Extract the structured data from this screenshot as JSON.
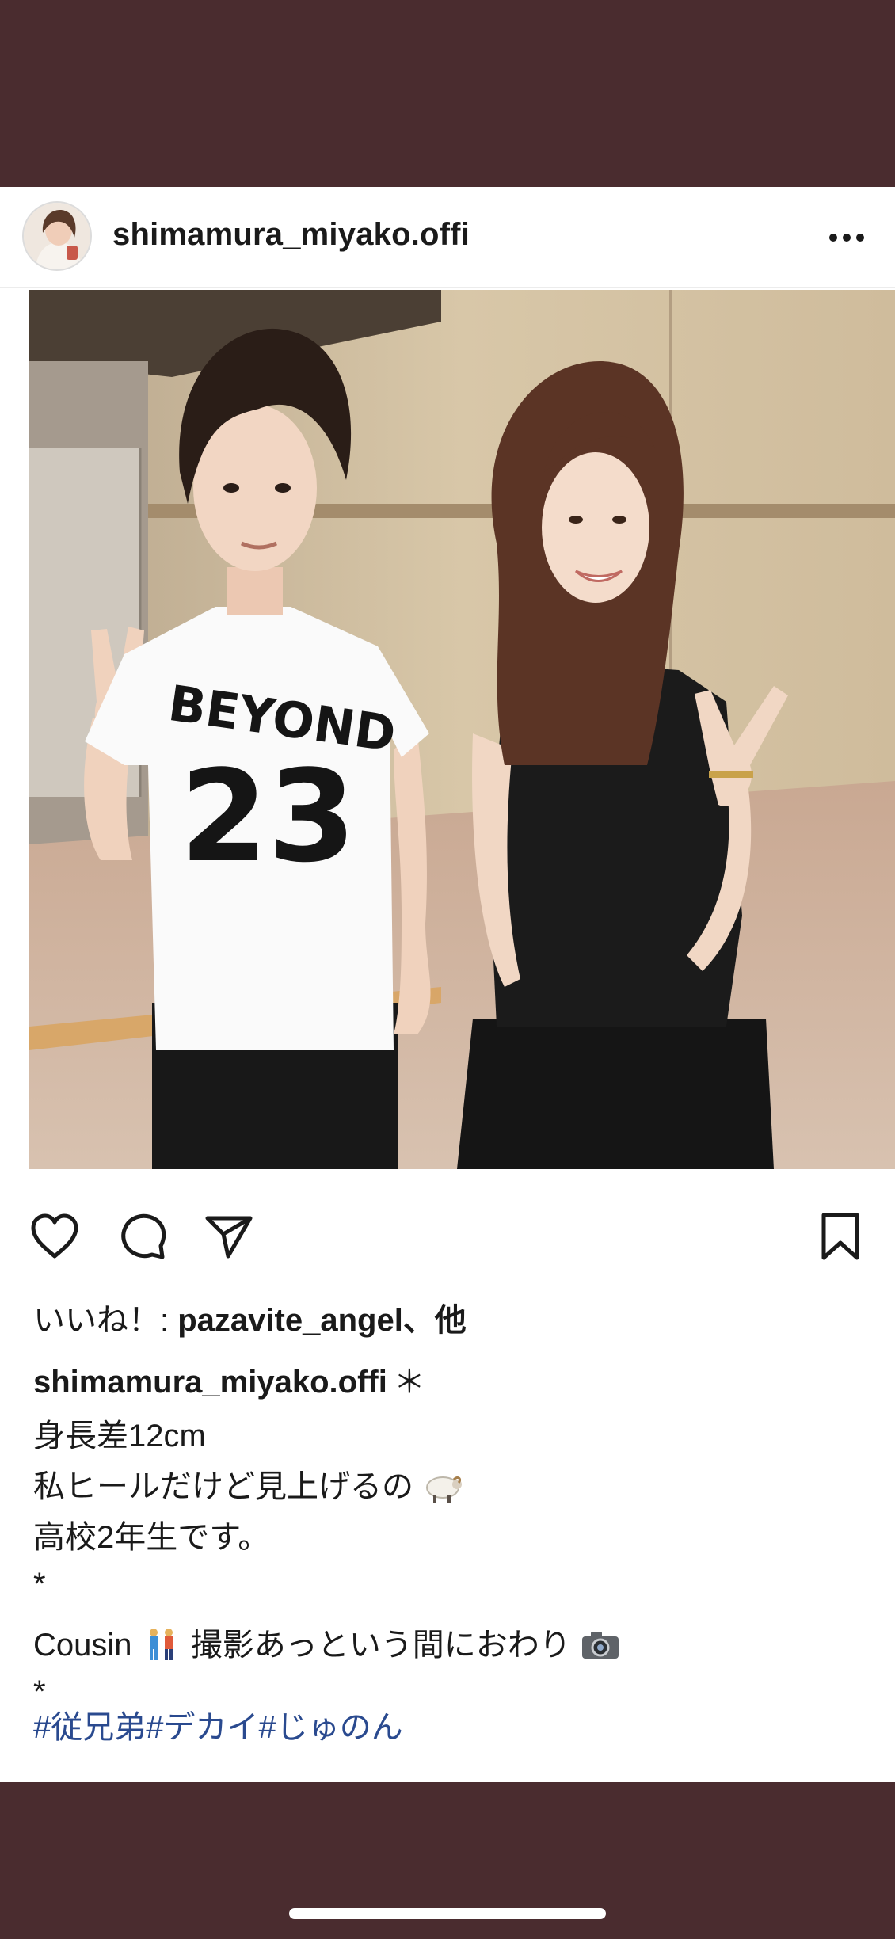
{
  "post": {
    "username": "shimamura_miyako.offi",
    "likes_prefix": "いいね！: ",
    "likes_user": "pazavite_angel",
    "likes_suffix": "、他",
    "caption_user": "shimamura_miyako.offi",
    "caption_star": "＊",
    "caption_lines": [
      "身長差12cm",
      "私ヒールだけど見上げるの",
      "高校2年生です。",
      "*",
      "Cousin",
      "撮影あっという間におわり",
      "*"
    ],
    "hashtags": [
      "#従兄弟",
      "#デカイ",
      "#じゅのん"
    ],
    "photo": {
      "shirt_text": "BEYOND",
      "shirt_number": "23"
    }
  },
  "icons": [
    "more-icon",
    "heart-icon",
    "comment-icon",
    "share-icon",
    "bookmark-icon",
    "sheep-emoji",
    "couple-emoji",
    "camera-emoji"
  ],
  "colors": {
    "band": "#4a2c2f",
    "text": "#1a1a1a",
    "hashtag": "#2a4a8f",
    "divider": "#ececec"
  }
}
